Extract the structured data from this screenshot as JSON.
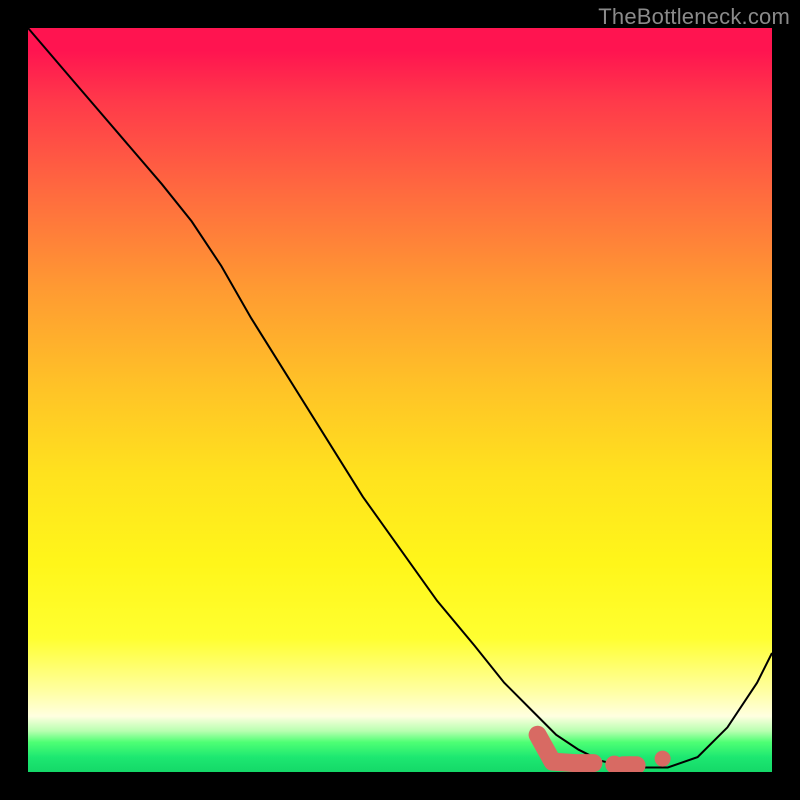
{
  "watermark": "TheBottleneck.com",
  "chart_data": {
    "type": "line",
    "title": "",
    "xlabel": "",
    "ylabel": "",
    "xlim": [
      0,
      100
    ],
    "ylim": [
      0,
      100
    ],
    "grid": false,
    "legend": false,
    "series": [
      {
        "name": "bottleneck-curve",
        "x": [
          0,
          6,
          12,
          18,
          22,
          26,
          30,
          35,
          40,
          45,
          50,
          55,
          60,
          64,
          68,
          71,
          74,
          77,
          80,
          82,
          86,
          90,
          94,
          98,
          100
        ],
        "y": [
          100,
          93,
          86,
          79,
          74,
          68,
          61,
          53,
          45,
          37,
          30,
          23,
          17,
          12,
          8,
          5,
          3,
          1.5,
          0.8,
          0.6,
          0.6,
          2,
          6,
          12,
          16
        ],
        "color": "#000000",
        "line_width": 2
      }
    ],
    "annotations": [
      {
        "name": "sweet-spot-marker",
        "type": "polyline",
        "color": "#d86a63",
        "line_width": 18,
        "linecap": "round",
        "points_x": [
          68.5,
          70.5,
          73.5,
          76.0
        ],
        "points_y": [
          5.0,
          1.4,
          1.2,
          1.2
        ]
      },
      {
        "name": "sweet-spot-dot-1",
        "type": "dot",
        "color": "#d86a63",
        "radius": 9,
        "x": 78.8,
        "y": 1.0
      },
      {
        "name": "sweet-spot-dash",
        "type": "polyline",
        "color": "#d86a63",
        "line_width": 18,
        "linecap": "round",
        "points_x": [
          80.0,
          81.8
        ],
        "points_y": [
          0.9,
          0.9
        ]
      },
      {
        "name": "sweet-spot-dot-2",
        "type": "dot",
        "color": "#d86a63",
        "radius": 8,
        "x": 85.3,
        "y": 1.8
      }
    ]
  }
}
